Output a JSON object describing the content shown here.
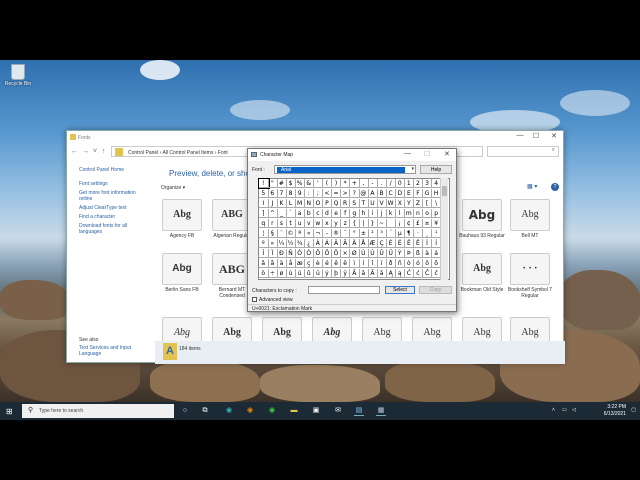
{
  "desktop": {
    "recycle_bin_label": "Recycle Bin"
  },
  "explorer": {
    "title": "Fonts",
    "address": "Control Panel  ›  All Control Panel Items  ›  Font",
    "search_placeholder": "⌕",
    "sidebar": {
      "home": "Control Panel Home",
      "links": [
        "Font settings",
        "Get more font information online",
        "Adjust ClearType text",
        "Find a character",
        "Download fonts for all languages"
      ],
      "see_also": "See also",
      "see_also_links": [
        "Text Services and Input Language"
      ]
    },
    "heading": "Preview, delete, or show a",
    "organize": "Organize ▾",
    "tiles": [
      {
        "preview": "Abg",
        "name": "Agency FB"
      },
      {
        "preview": "ABG",
        "name": "Algerian Regular"
      },
      {
        "preview": "Abg",
        "name": "Bauhaus 93 Regular"
      },
      {
        "preview": "Abg",
        "name": "Bell MT"
      },
      {
        "preview": "Abg",
        "name": "Berlin Sans FB"
      },
      {
        "preview": "ABG",
        "name": "Bernard MT Condensed"
      },
      {
        "preview": "Abg",
        "name": "Bookman Old Style"
      },
      {
        "preview": "· · ·",
        "name": "Bookshelf Symbol 7 Regular"
      },
      {
        "preview": "Abg",
        "name": ""
      },
      {
        "preview": "Abg",
        "name": ""
      },
      {
        "preview": "Abg",
        "name": ""
      },
      {
        "preview": "Abg",
        "name": ""
      },
      {
        "preview": "Abg",
        "name": ""
      },
      {
        "preview": "Abg",
        "name": ""
      },
      {
        "preview": "Abg",
        "name": ""
      },
      {
        "preview": "Abg",
        "name": ""
      }
    ],
    "item_count": "184 items"
  },
  "charmap": {
    "title": "Character Map",
    "font_label": "Font :",
    "font_value": "Arial",
    "help_label": "Help",
    "rows": [
      [
        "!",
        "\"",
        "#",
        "$",
        "%",
        "&",
        "'",
        "(",
        ")",
        "*",
        "+",
        ",",
        "-",
        ".",
        "/",
        "0",
        "1",
        "2",
        "3",
        "4"
      ],
      [
        "5",
        "6",
        "7",
        "8",
        "9",
        ":",
        ";",
        "<",
        "=",
        ">",
        "?",
        "@",
        "A",
        "B",
        "C",
        "D",
        "E",
        "F",
        "G",
        "H"
      ],
      [
        "I",
        "J",
        "K",
        "L",
        "M",
        "N",
        "O",
        "P",
        "Q",
        "R",
        "S",
        "T",
        "U",
        "V",
        "W",
        "X",
        "Y",
        "Z",
        "[",
        "\\"
      ],
      [
        "]",
        "^",
        "_",
        "`",
        "a",
        "b",
        "c",
        "d",
        "e",
        "f",
        "g",
        "h",
        "i",
        "j",
        "k",
        "l",
        "m",
        "n",
        "o",
        "p"
      ],
      [
        "q",
        "r",
        "s",
        "t",
        "u",
        "v",
        "w",
        "x",
        "y",
        "z",
        "{",
        "|",
        "}",
        "~",
        " ",
        "¡",
        "¢",
        "£",
        "¤",
        "¥"
      ],
      [
        "¦",
        "§",
        "¨",
        "©",
        "ª",
        "«",
        "¬",
        "-",
        "®",
        "¯",
        "°",
        "±",
        "²",
        "³",
        "´",
        "µ",
        "¶",
        "·",
        "¸",
        "¹"
      ],
      [
        "º",
        "»",
        "¼",
        "½",
        "¾",
        "¿",
        "À",
        "Á",
        "Â",
        "Ã",
        "Ä",
        "Å",
        "Æ",
        "Ç",
        "È",
        "É",
        "Ê",
        "Ë",
        "Ì",
        "Í"
      ],
      [
        "Î",
        "Ï",
        "Ð",
        "Ñ",
        "Ò",
        "Ó",
        "Ô",
        "Õ",
        "Ö",
        "×",
        "Ø",
        "Ù",
        "Ú",
        "Û",
        "Ü",
        "Ý",
        "Þ",
        "ß",
        "à",
        "á"
      ],
      [
        "â",
        "ã",
        "ä",
        "å",
        "æ",
        "ç",
        "è",
        "é",
        "ê",
        "ë",
        "ì",
        "í",
        "î",
        "ï",
        "ð",
        "ñ",
        "ò",
        "ó",
        "ô",
        "õ"
      ],
      [
        "ö",
        "÷",
        "ø",
        "ù",
        "ú",
        "û",
        "ü",
        "ý",
        "þ",
        "ÿ",
        "Ā",
        "ā",
        "Ă",
        "ă",
        "Ą",
        "ą",
        "Ć",
        "ć",
        "Ĉ",
        "ĉ"
      ]
    ],
    "copy_label": "Characters to copy :",
    "select_label": "Select",
    "copy_button": "Copy",
    "advanced_label": "Advanced view",
    "status": "U+0021: Exclamation Mark"
  },
  "taskbar": {
    "search_placeholder": "Type here to search",
    "time": "3:22 PM",
    "date": "6/13/2021"
  }
}
